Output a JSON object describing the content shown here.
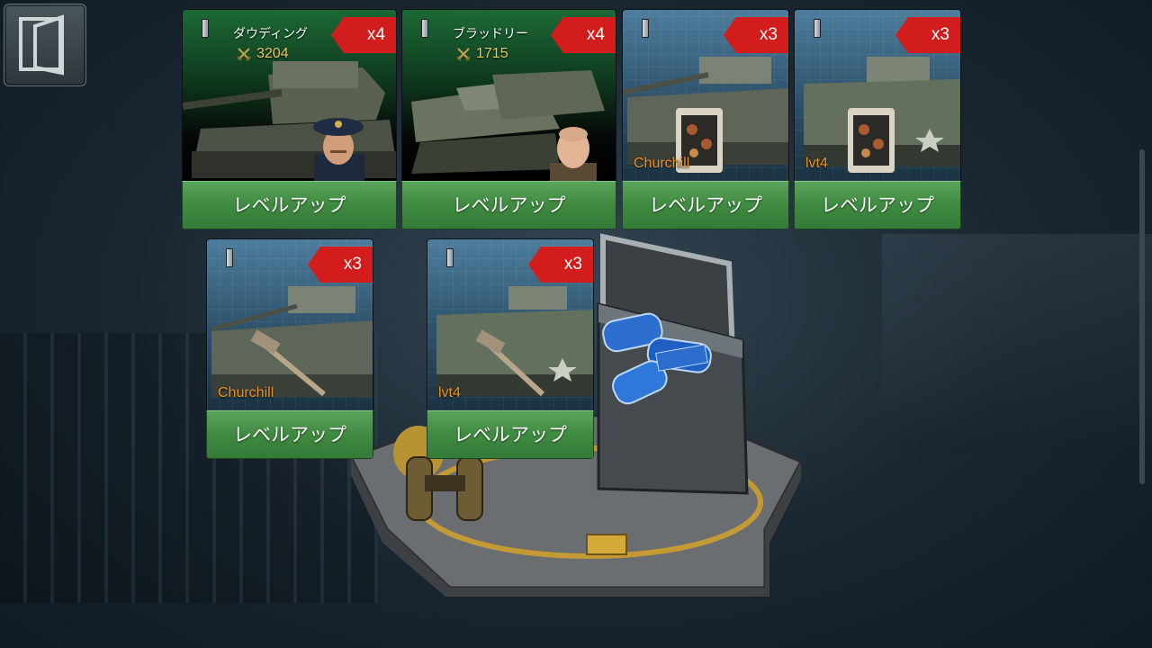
{
  "rewards": [
    {
      "kind": "hero",
      "name": "ダウディング",
      "power": "3204",
      "quantity": "x4",
      "button": "レベルアップ"
    },
    {
      "kind": "hero",
      "name": "ブラッドリー",
      "power": "1715",
      "quantity": "x4",
      "button": "レベルアップ"
    },
    {
      "kind": "part",
      "label": "Churchill",
      "quantity": "x3",
      "button": "レベルアップ"
    },
    {
      "kind": "part",
      "label": "lvt4",
      "quantity": "x3",
      "button": "レベルアップ"
    },
    {
      "kind": "part",
      "label": "Churchill",
      "quantity": "x3",
      "button": "レベルアップ"
    },
    {
      "kind": "part",
      "label": "lvt4",
      "quantity": "x3",
      "button": "レベルアップ"
    }
  ],
  "colors": {
    "quantity_badge": "#d31d1d",
    "level_up_button": "#4a954c",
    "power_text": "#e6c768",
    "item_label": "#e8942c"
  },
  "icons": {
    "exit": "exit-door-icon",
    "rank": "rank-bar-icon",
    "power": "crossed-swords-icon"
  }
}
